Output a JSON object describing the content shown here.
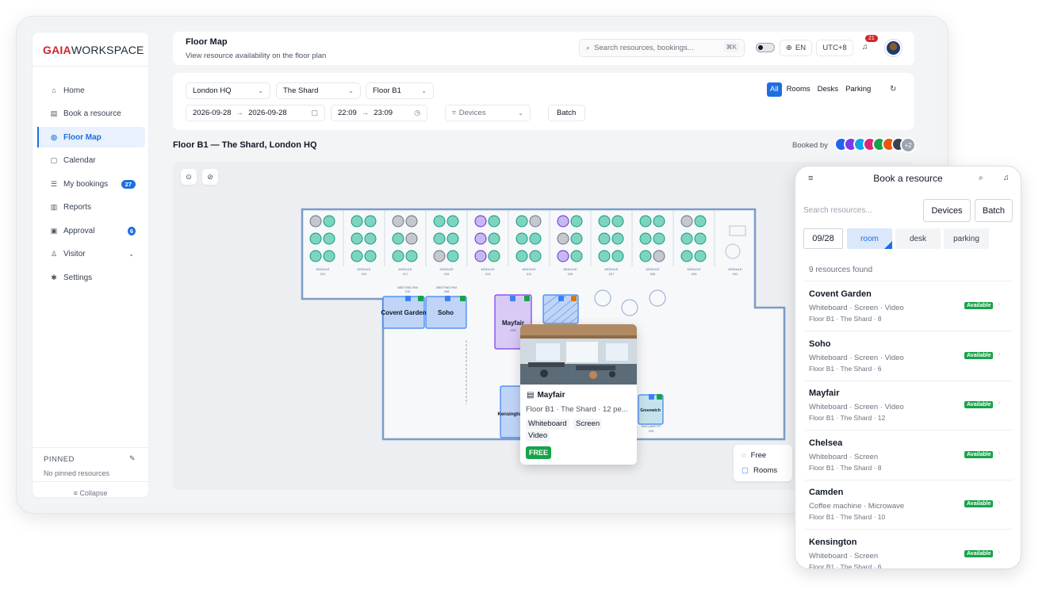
{
  "brand": {
    "logo_bold": "GAIA",
    "logo_rest": "WORKSPACE"
  },
  "sidebar": {
    "items": [
      {
        "label": "Home",
        "icon": "home-icon",
        "glyph": "⌂"
      },
      {
        "label": "Book a resource",
        "icon": "book-icon",
        "glyph": "▤"
      },
      {
        "label": "Floor Map",
        "icon": "map-pin-icon",
        "glyph": "◎"
      },
      {
        "label": "Calendar",
        "icon": "calendar-icon",
        "glyph": "▢"
      },
      {
        "label": "My bookings",
        "icon": "list-icon",
        "glyph": "☰",
        "badge": "27"
      },
      {
        "label": "Reports",
        "icon": "chart-icon",
        "glyph": "▥"
      },
      {
        "label": "Approval",
        "icon": "approval-icon",
        "glyph": "▣",
        "badge": "6"
      },
      {
        "label": "Visitor",
        "icon": "visitor-icon",
        "glyph": "♙"
      },
      {
        "label": "Settings",
        "icon": "gear-icon",
        "glyph": "✱"
      }
    ],
    "pinned_title": "PINNED",
    "pinned_empty": "No pinned resources",
    "collapse": "≡ Collapse"
  },
  "header": {
    "title": "Floor Map",
    "subtitle": "View resource availability on the floor plan",
    "search_placeholder": "Search resources, bookings...",
    "search_shortcut": "⌘K",
    "language": "EN",
    "timezone": "UTC+8",
    "notifications": "21"
  },
  "filters": {
    "site": "London HQ",
    "building": "The Shard",
    "floor": "Floor B1",
    "date_from": "2026-09-28",
    "date_to": "2026-09-28",
    "time_from": "22:09",
    "time_to": "23:09",
    "devices": "Devices",
    "batch": "Batch",
    "types": [
      "All",
      "Rooms",
      "Desks",
      "Parking"
    ],
    "active_type": "All"
  },
  "map": {
    "title": "Floor B1 — The Shard, London HQ",
    "booked_by": "Booked by",
    "booked_more": "+2",
    "modules": [
      {
        "label": "MODULE",
        "num": "221"
      },
      {
        "label": "MODULE",
        "num": "219"
      },
      {
        "label": "MODULE",
        "num": "217"
      },
      {
        "label": "MODULE",
        "num": "215"
      },
      {
        "label": "MODULE",
        "num": "213"
      },
      {
        "label": "MODULE",
        "num": "211"
      },
      {
        "label": "MODULE",
        "num": "209"
      },
      {
        "label": "MODULE",
        "num": "207"
      },
      {
        "label": "MODULE",
        "num": "205"
      },
      {
        "label": "MODULE",
        "num": "203"
      },
      {
        "label": "MODULE",
        "num": "201"
      }
    ],
    "rooms": {
      "covent_garden": "Covent Garden",
      "soho": "Soho",
      "mayfair": "Mayfair",
      "mayfair_num": "225",
      "kensington": "Kensington",
      "greenwich": "Greenwich",
      "meeting_a": "MEETING RM",
      "meeting_a_num": "210",
      "meeting_b": "MEETING RM",
      "meeting_b_num": "208",
      "enclave": "ENCLAVE RT",
      "enclave_num": "229"
    },
    "tooltip": {
      "name": "Mayfair",
      "subtitle": "Floor B1 · The Shard · 12 pe...",
      "tags": [
        "Whiteboard",
        "Screen",
        "Video"
      ],
      "status": "FREE"
    },
    "legend": [
      "Free",
      "Rooms"
    ]
  },
  "phone": {
    "title": "Book a resource",
    "search_placeholder": "Search resources...",
    "devices": "Devices",
    "batch": "Batch",
    "date": "09/28",
    "chips": [
      "room",
      "desk",
      "parking"
    ],
    "found": "9 resources found",
    "results": [
      {
        "name": "Covent Garden",
        "features": "Whiteboard · Screen · Video",
        "location": "Floor B1 · The Shard · 8",
        "status": "Available"
      },
      {
        "name": "Soho",
        "features": "Whiteboard · Screen · Video",
        "location": "Floor B1 · The Shard · 6",
        "status": "Available"
      },
      {
        "name": "Mayfair",
        "features": "Whiteboard · Screen · Video",
        "location": "Floor B1 · The Shard · 12",
        "status": "Available"
      },
      {
        "name": "Chelsea",
        "features": "Whiteboard · Screen",
        "location": "Floor B1 · The Shard · 8",
        "status": "Available"
      },
      {
        "name": "Camden",
        "features": "Coffee machine · Microwave",
        "location": "Floor B1 · The Shard · 10",
        "status": "Available"
      },
      {
        "name": "Kensington",
        "features": "Whiteboard · Screen",
        "location": "Floor B1 · The Shard · 6",
        "status": "Available"
      }
    ]
  },
  "colors": {
    "accent": "#1d6fe0",
    "brand_red": "#d0262d",
    "free_green": "#17a34a"
  }
}
